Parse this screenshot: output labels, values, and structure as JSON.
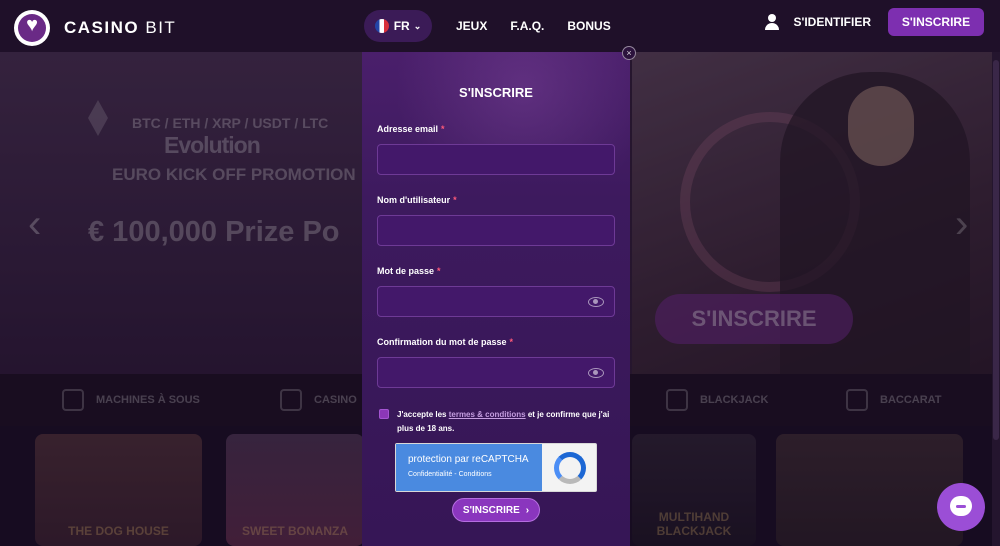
{
  "header": {
    "brand_bold": "CASINO",
    "brand_light": "BIT",
    "language": "FR",
    "nav": [
      "JEUX",
      "F.A.Q.",
      "BONUS"
    ],
    "login_label": "S'IDENTIFIER",
    "signup_label": "S'INSCRIRE"
  },
  "hero": {
    "line1": "BTC / ETH / XRP / USDT / LTC",
    "line2": "Evolution",
    "line3": "EURO KICK OFF PROMOTION",
    "line4": "€ 100,000 Prize Po",
    "cta": "S'INSCRIRE"
  },
  "categories": [
    "MACHINES À SOUS",
    "CASINO",
    "BLACKJACK",
    "BACCARAT"
  ],
  "tiles": [
    "THE DOG HOUSE",
    "SWEET BONANZA",
    "MULTIHAND BLACKJACK",
    ""
  ],
  "modal": {
    "title": "S'INSCRIRE",
    "fields": [
      {
        "label": "Adresse email",
        "value": "",
        "type": "email"
      },
      {
        "label": "Nom d'utilisateur",
        "value": "",
        "type": "text"
      },
      {
        "label": "Mot de passe",
        "value": "",
        "type": "password"
      },
      {
        "label": "Confirmation du mot de passe",
        "value": "",
        "type": "password"
      }
    ],
    "required_mark": "*",
    "terms_before": "J'accepte les ",
    "terms_link": "termes & conditions",
    "terms_after": " et je confirme que j'ai plus de 18 ans.",
    "captcha_main": "protection par reCAPTCHA",
    "captcha_sub": "Confidentialité - Conditions",
    "submit_label": "S'INSCRIRE",
    "close_glyph": "×"
  },
  "colors": {
    "accent": "#7d2fb0",
    "modal_bg": "#3d1a5e",
    "input_bg": "#43186a",
    "required": "#ff5a7a"
  },
  "icons": [
    "heart-logo-icon",
    "france-flag-icon",
    "chevron-down-icon",
    "user-icon",
    "eye-icon",
    "close-icon",
    "recaptcha-icon",
    "chat-icon",
    "chevron-right-icon"
  ]
}
